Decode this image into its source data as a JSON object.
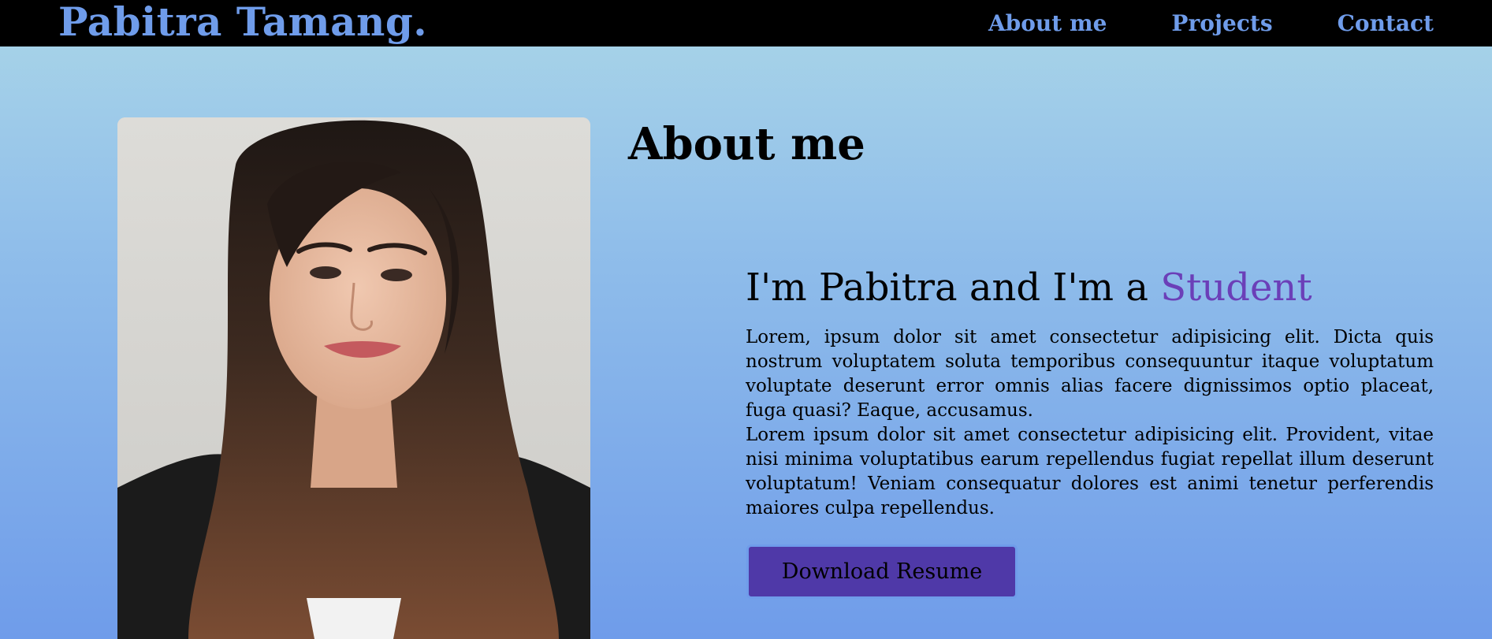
{
  "header": {
    "brand": "Pabitra Tamang.",
    "nav": [
      {
        "label": "About me"
      },
      {
        "label": "Projects"
      },
      {
        "label": "Contact"
      }
    ]
  },
  "about": {
    "title": "About me",
    "intro_prefix": "I'm Pabitra and I'm a ",
    "intro_role": "Student",
    "paragraphs": [
      "Lorem, ipsum dolor sit amet consectetur adipisicing elit. Dicta quis nostrum voluptatem soluta temporibus consequuntur itaque voluptatum voluptate deserunt error omnis alias facere dignissimos optio placeat, fuga quasi? Eaque, accusamus.",
      "Lorem ipsum dolor sit amet consectetur adipisicing elit. Provident, vitae nisi minima voluptatibus earum repellendus fugiat repellat illum deserunt voluptatum! Veniam consequatur dolores est animi tenetur perferendis maiores culpa repellendus."
    ],
    "resume_button": "Download Resume"
  },
  "colors": {
    "header_bg": "#000000",
    "brand_accent": "#6f9cea",
    "role_accent": "#6b3fb8",
    "button_bg": "#4f39a8"
  }
}
